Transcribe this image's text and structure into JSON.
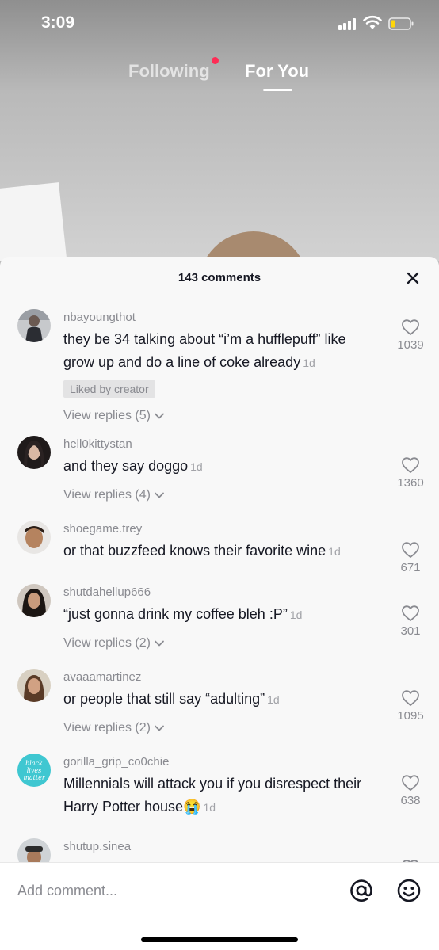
{
  "status_bar": {
    "time": "3:09"
  },
  "top_tabs": {
    "following": "Following",
    "for_you": "For You"
  },
  "sheet": {
    "comment_count": "143 comments"
  },
  "comments": [
    {
      "username": "nbayoungthot",
      "text": "they be 34 talking about “i’m a hufflepuff” like grow up and do a line of coke already",
      "age": "1d",
      "badge": "Liked by creator",
      "replies": "View replies (5)",
      "likes": "1039"
    },
    {
      "username": "hell0kittystan",
      "text": "and they say doggo",
      "age": "1d",
      "replies": "View replies (4)",
      "likes": "1360"
    },
    {
      "username": "shoegame.trey",
      "text": "or that buzzfeed knows their favorite wine",
      "age": "1d",
      "likes": "671"
    },
    {
      "username": "shutdahellup666",
      "text": "“just gonna drink my coffee bleh :P”",
      "age": "1d",
      "replies": "View replies (2)",
      "likes": "301"
    },
    {
      "username": "avaaamartinez",
      "text": "or people that still say “adulting”",
      "age": "1d",
      "replies": "View replies (2)",
      "likes": "1095"
    },
    {
      "username": "gorilla_grip_co0chie",
      "text": "Millennials will attack you if you disrespect their Harry Potter house😭",
      "age": "1d",
      "avatar_text": "black lives matter",
      "likes": "638"
    },
    {
      "username": "shutup.sinea"
    }
  ],
  "bottom": {
    "placeholder": "Add comment..."
  },
  "colors": {
    "accent": "#fe2c55",
    "sheet_bg": "#f8f8f8",
    "secondary_text": "#8a8b91",
    "avatar_teal": "#3fc7d1"
  },
  "icons": {
    "close": "close-icon",
    "like": "heart-outline-icon",
    "mention": "at-icon",
    "emoji": "emoji-icon",
    "expand": "chevron-down-icon"
  }
}
